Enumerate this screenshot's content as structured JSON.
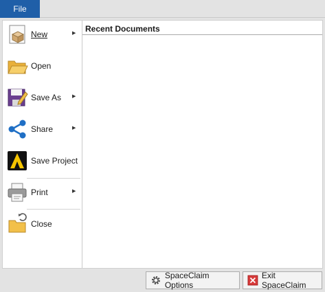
{
  "tab": {
    "file": "File"
  },
  "menu": {
    "new": "New",
    "open": "Open",
    "save_as": "Save As",
    "share": "Share",
    "save_project": "Save Project",
    "print": "Print",
    "close": "Close",
    "submenu_arrow": "▶"
  },
  "recent": {
    "title": "Recent Documents"
  },
  "footer": {
    "options": "SpaceClaim Options",
    "exit": "Exit SpaceClaim"
  },
  "colors": {
    "file_tab": "#1f5fa8",
    "folder": "#f2c04a",
    "share": "#1f6fc5",
    "exit_red": "#d83b3b"
  },
  "icons": [
    "new-document-icon",
    "open-folder-icon",
    "save-as-icon",
    "share-icon",
    "spaceclaim-logo-icon",
    "printer-icon",
    "close-folder-icon",
    "gear-icon",
    "exit-icon"
  ]
}
